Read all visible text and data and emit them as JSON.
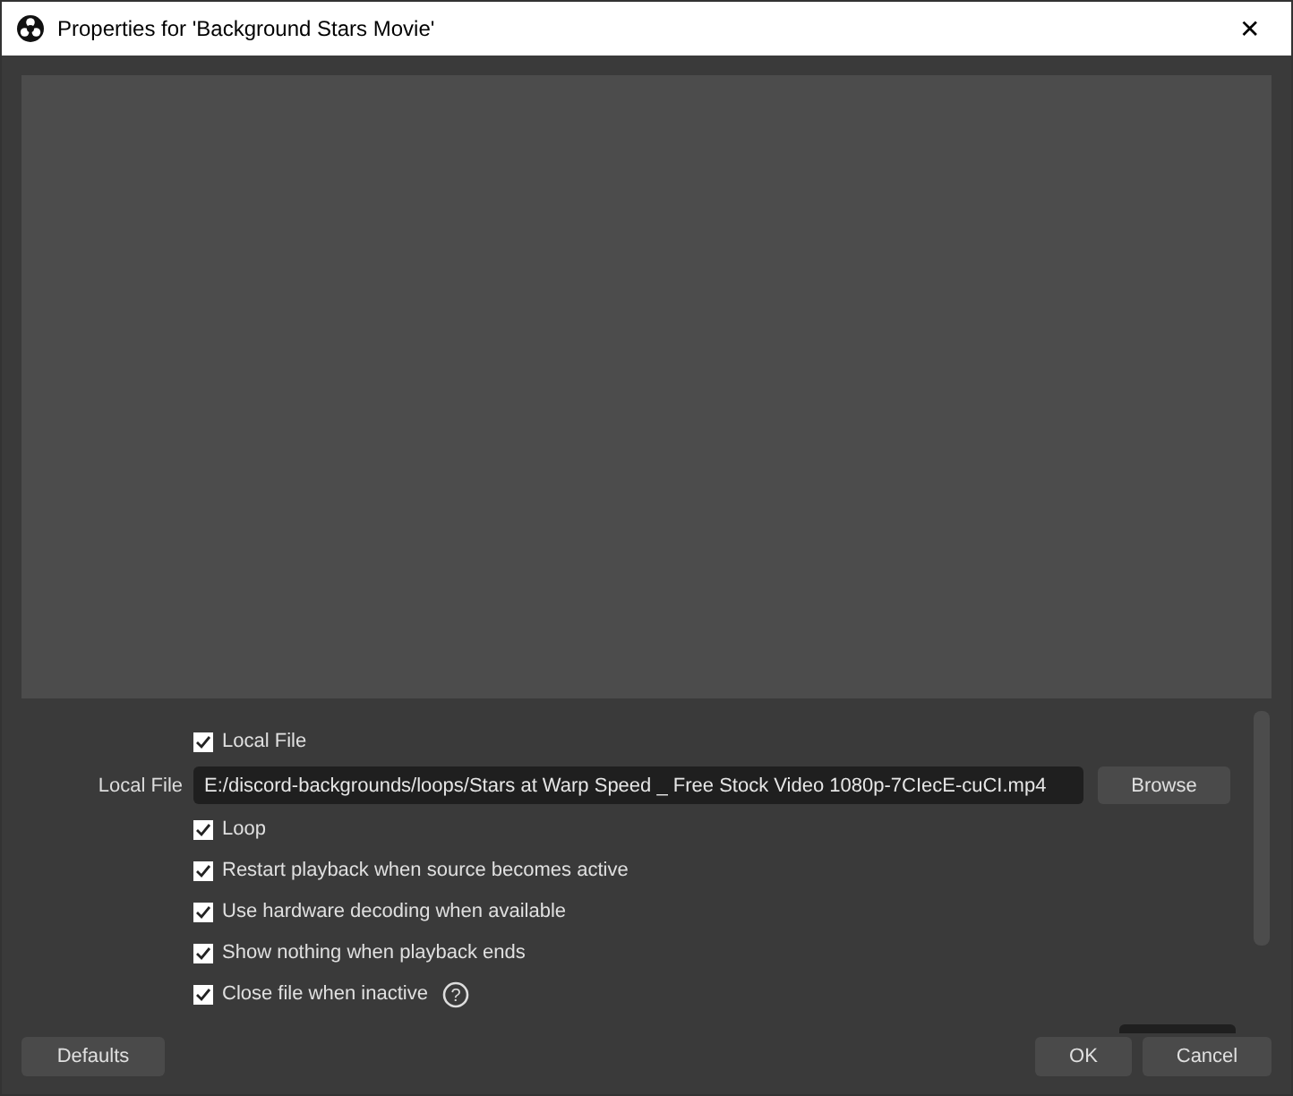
{
  "window": {
    "title": "Properties for 'Background Stars Movie'",
    "close": "✕"
  },
  "preview": {
    "kind": "empty"
  },
  "properties": [
    {
      "kind": "checkbox",
      "label": "Local File",
      "checked": true
    },
    {
      "kind": "path",
      "label": "Local File",
      "value": "E:/discord-backgrounds/loops/Stars at Warp Speed _ Free Stock Video 1080p-7CIecE-cuCI.mp4",
      "button": "Browse"
    },
    {
      "kind": "checkbox",
      "label": "Loop",
      "checked": true
    },
    {
      "kind": "checkbox",
      "label": "Restart playback when source becomes active",
      "checked": true
    },
    {
      "kind": "checkbox",
      "label": "Use hardware decoding when available",
      "checked": true
    },
    {
      "kind": "checkbox",
      "label": "Show nothing when playback ends",
      "checked": true
    },
    {
      "kind": "checkbox",
      "label": "Close file when inactive",
      "checked": true,
      "help": "?"
    }
  ],
  "buttons": {
    "defaults": "Defaults",
    "ok": "OK",
    "cancel": "Cancel"
  }
}
